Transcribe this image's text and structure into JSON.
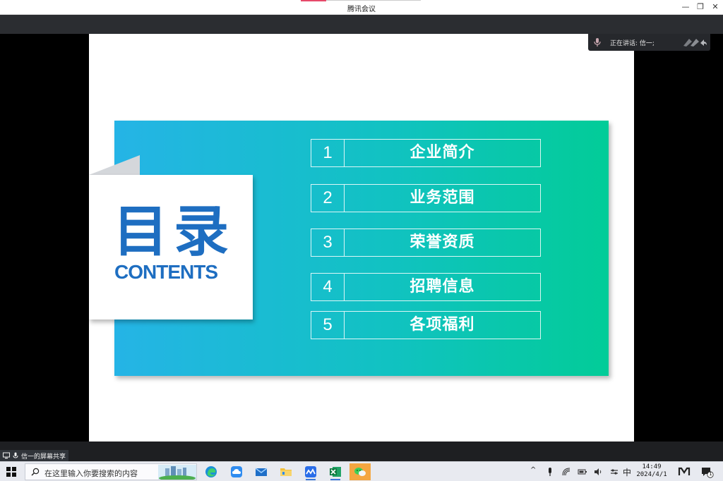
{
  "window": {
    "title": "腾讯会议",
    "minimize_glyph": "—",
    "restore_glyph": "❐",
    "close_glyph": "✕"
  },
  "speaker": {
    "label": "正在讲话: 信一;"
  },
  "slide": {
    "big_title": "目录",
    "sub_title": "CONTENTS",
    "items": [
      {
        "num": "1",
        "label": "企业简介"
      },
      {
        "num": "2",
        "label": "业务范围"
      },
      {
        "num": "3",
        "label": "荣誉资质"
      },
      {
        "num": "4",
        "label": "招聘信息"
      },
      {
        "num": "5",
        "label": "各项福利"
      }
    ],
    "colors": {
      "gradient_start": "#25b4e6",
      "gradient_end": "#02cc98",
      "title_blue": "#1e6ec1"
    }
  },
  "share": {
    "label": "信一的屏幕共享"
  },
  "taskbar": {
    "search_placeholder": "在这里输入你要搜索的内容",
    "apps": [
      "edge-icon",
      "cloud-drive-icon",
      "mail-icon",
      "file-explorer-icon",
      "tencent-meeting-icon",
      "excel-icon",
      "wechat-icon"
    ],
    "ime": "中",
    "time": "14:49",
    "date": "2024/4/1",
    "notification_count": "1"
  }
}
